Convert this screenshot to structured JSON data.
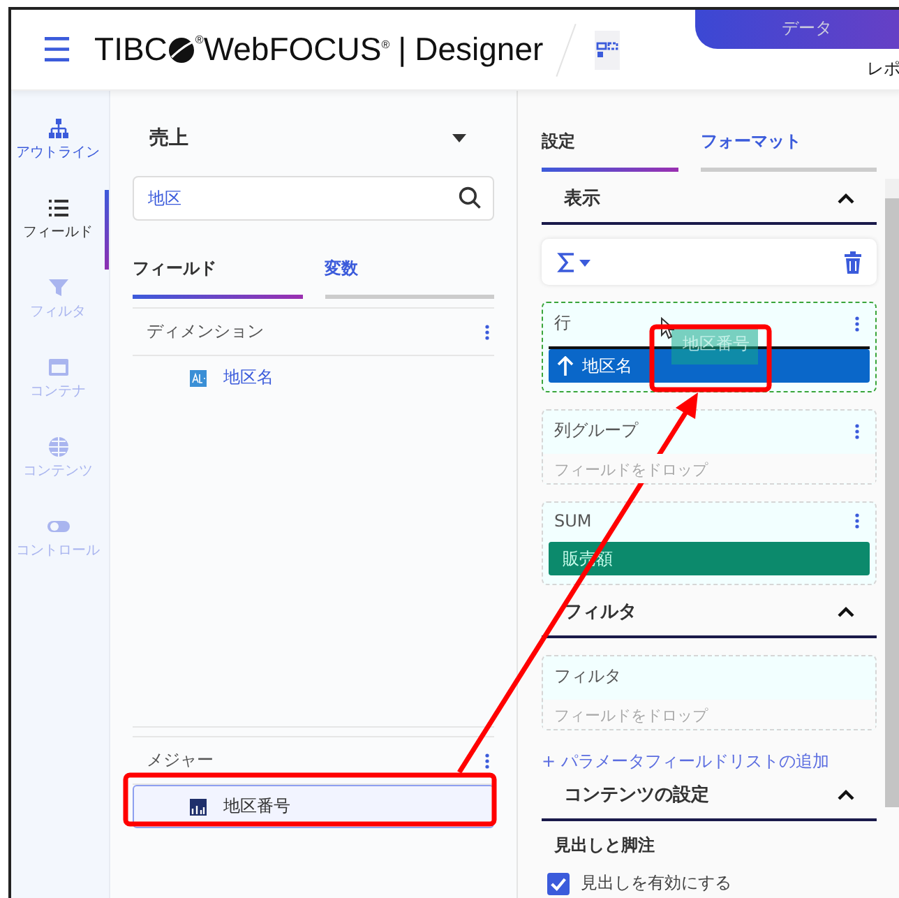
{
  "header": {
    "menu_label": "☰",
    "brand_prefix": "TIBC",
    "brand_mark": "®",
    "brand_name": "WebFOCUS$^{®}$",
    "divider": "|",
    "product": "Designer"
  },
  "top_tabs": [
    {
      "label": "データ",
      "selected": true
    },
    {
      "label": "レポ",
      "selected": false
    }
  ],
  "rail": [
    {
      "label": "アウトライン",
      "selected": false,
      "disabled": false
    },
    {
      "label": "フィールド",
      "selected": true,
      "disabled": false
    },
    {
      "label": "フィルタ",
      "selected": false,
      "disabled": true
    },
    {
      "label": "コンテナ",
      "selected": false,
      "disabled": true
    },
    {
      "label": "コンテンツ",
      "selected": false,
      "disabled": true
    },
    {
      "label": "コントロール",
      "selected": false,
      "disabled": true
    }
  ],
  "fields_panel": {
    "source": "売上",
    "search": {
      "value": "地区"
    },
    "tabs": [
      {
        "label": "フィールド",
        "selected": true
      },
      {
        "label": "変数",
        "selected": false
      }
    ],
    "dimensions": {
      "title": "ディメンション",
      "items": [
        {
          "label": "地区名",
          "selected": false
        }
      ]
    },
    "measures": {
      "title": "メジャー",
      "items": [
        {
          "label": "地区番号",
          "selected": true
        }
      ]
    }
  },
  "settings_panel": {
    "tabs": [
      {
        "label": "設定",
        "selected": true
      },
      {
        "label": "フォーマット",
        "selected": false
      }
    ],
    "display": {
      "title": "表示",
      "expanded": true,
      "zones": [
        {
          "title": "行",
          "active": true,
          "items": [
            {
              "label": "地区名",
              "kind": "dimension"
            }
          ],
          "drag_ghost": "地区番号"
        },
        {
          "title": "列グループ",
          "active": false,
          "placeholder": "フィールドをドロップ"
        },
        {
          "title": "SUM",
          "active": false,
          "items": [
            {
              "label": "販売額",
              "kind": "measure"
            }
          ]
        }
      ]
    },
    "filter": {
      "title": "フィルタ",
      "expanded": true,
      "zone": {
        "title": "フィルタ",
        "placeholder": "フィールドをドロップ"
      }
    },
    "add_link": "+ パラメータフィールドリストの追加",
    "content": {
      "title": "コンテンツの設定",
      "expanded": true,
      "subheading": "見出しと脚注",
      "checkbox": {
        "label": "見出しを有効にする",
        "checked": true
      }
    }
  }
}
